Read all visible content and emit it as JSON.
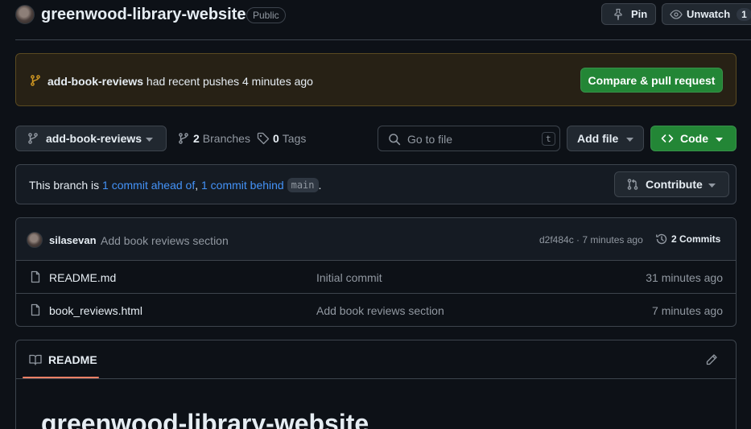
{
  "header": {
    "repo_name": "greenwood-library-website",
    "visibility": "Public",
    "pin_label": "Pin",
    "watch_label": "Unwatch",
    "watch_count": "1"
  },
  "banner": {
    "branch": "add-book-reviews",
    "message": "had recent pushes 4 minutes ago",
    "compare_label": "Compare & pull request"
  },
  "toolbar": {
    "branch_select": "add-book-reviews",
    "branches_count": "2",
    "branches_label": "Branches",
    "tags_count": "0",
    "tags_label": "Tags",
    "search_placeholder": "Go to file",
    "search_shortcut": "t",
    "add_file_label": "Add file",
    "code_label": "Code"
  },
  "branch_status": {
    "prefix": "This branch is",
    "ahead": "1 commit ahead of",
    "separator": ",",
    "behind": "1 commit behind",
    "base": "main",
    "suffix": ".",
    "contribute_label": "Contribute"
  },
  "latest_commit": {
    "author": "silasevan",
    "message": "Add book reviews section",
    "meta": "d2f484c · 7 minutes ago",
    "commits_label": "2 Commits"
  },
  "files": [
    {
      "name": "README.md",
      "commit": "Initial commit",
      "time": "31 minutes ago"
    },
    {
      "name": "book_reviews.html",
      "commit": "Add book reviews section",
      "time": "7 minutes ago"
    }
  ],
  "readme": {
    "tab_label": "README",
    "heading": "greenwood-library-website"
  },
  "colors": {
    "background": "#0d1117",
    "accent_green": "#238636",
    "link_blue": "#4493f8",
    "banner_bg": "#272115",
    "branch_icon_orange": "#d29922",
    "tab_underline": "#f78166"
  }
}
